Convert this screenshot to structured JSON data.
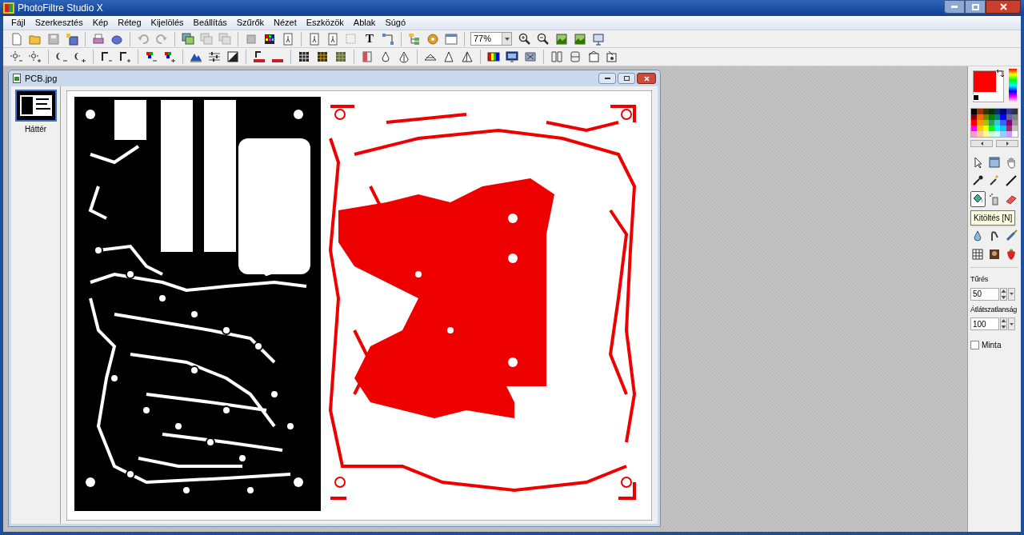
{
  "window": {
    "title": "PhotoFiltre Studio X"
  },
  "menu": [
    {
      "label": "Fájl"
    },
    {
      "label": "Szerkesztés"
    },
    {
      "label": "Kép"
    },
    {
      "label": "Réteg"
    },
    {
      "label": "Kijelölés"
    },
    {
      "label": "Beállítás"
    },
    {
      "label": "Szűrők"
    },
    {
      "label": "Nézet"
    },
    {
      "label": "Eszközök"
    },
    {
      "label": "Ablak"
    },
    {
      "label": "Súgó"
    }
  ],
  "toolbar": {
    "text_tool_glyph": "T",
    "zoom": "77%"
  },
  "document": {
    "title": "PCB.jpg",
    "layers": [
      {
        "label": "Háttér",
        "selected": true
      }
    ]
  },
  "tooltip": "Kitöltés [N]",
  "tool_options": [
    {
      "label": "Tűrés",
      "value": "50"
    },
    {
      "label": "Átlátszatlanság",
      "value": "100"
    }
  ],
  "pattern": {
    "label": "Minta",
    "checked": false
  }
}
